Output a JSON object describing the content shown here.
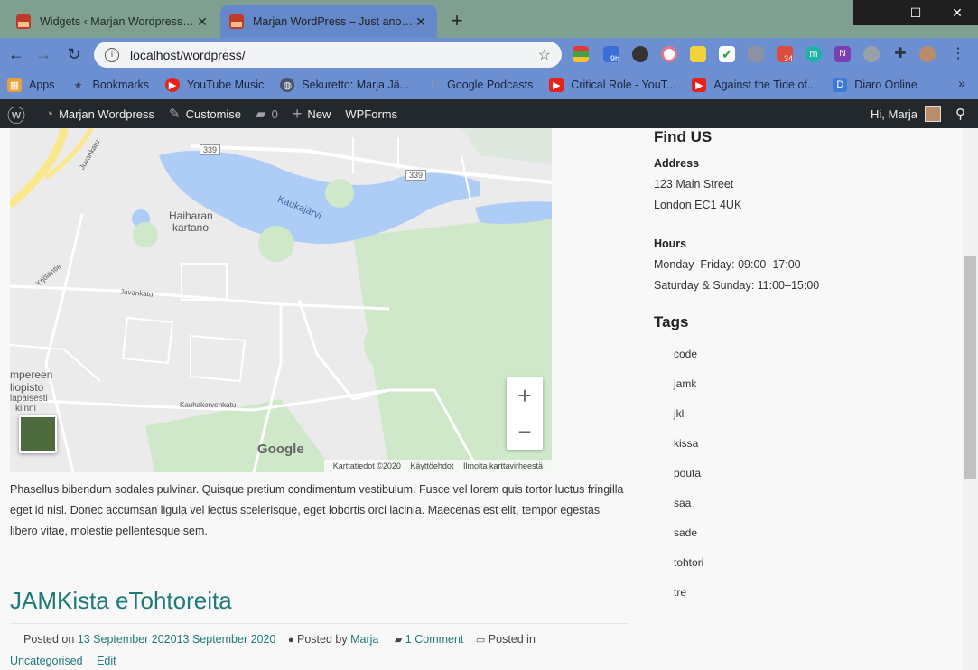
{
  "browser": {
    "tabs": [
      {
        "title": "Widgets ‹ Marjan Wordpress — WordPress"
      },
      {
        "title": "Marjan WordPress – Just another WordPress site"
      }
    ],
    "new_tab": "+",
    "window_controls": {
      "minimize": "—",
      "maximize": "☐",
      "close": "✕"
    },
    "url": "localhost/wordpress/",
    "extension_badges": {
      "timer": "9h",
      "todo": "34"
    },
    "bookmarks": [
      {
        "label": "Apps",
        "icon": "apps-grid-icon",
        "color": "#e8a03a"
      },
      {
        "label": "Bookmarks",
        "icon": "star-icon",
        "color": "#5a6480"
      },
      {
        "label": "YouTube Music",
        "icon": "youtube-music-icon",
        "color": "#e62117"
      },
      {
        "label": "Sekuretto: Marja Jä...",
        "icon": "globe-icon",
        "color": "#5a6480"
      },
      {
        "label": "Google Podcasts",
        "icon": "google-podcasts-icon",
        "color": "#f4b400"
      },
      {
        "label": "Critical Role - YouT...",
        "icon": "youtube-icon",
        "color": "#e62117"
      },
      {
        "label": "Against the Tide of...",
        "icon": "youtube-icon",
        "color": "#e62117"
      },
      {
        "label": "Diaro Online",
        "icon": "diaro-icon",
        "color": "#3a7bd5"
      }
    ],
    "bookmarks_more": "»"
  },
  "adminbar": {
    "site_name": "Marjan Wordpress",
    "customise": "Customise",
    "comments_count": "0",
    "new": "New",
    "wpforms": "WPForms",
    "greeting": "Hi, Marja"
  },
  "map": {
    "labels": {
      "road_339a": "339",
      "road_339b": "339",
      "lake": "Kaukajärvi",
      "place1": "Haiharan",
      "place2": "kartano",
      "road1": "Juvankatu",
      "road2": "Juvankatu",
      "road3": "Yrjöläntie",
      "road4": "Kauhakorvenkatu",
      "place3": "mpereen",
      "place4": "liopisto",
      "place5": "lapäisesti",
      "place6": "kiinni"
    },
    "zoom_in": "+",
    "zoom_out": "−",
    "google": "Google",
    "attribution": {
      "data": "Karttatiedot ©2020",
      "terms": "Käyttöehdot",
      "report": "Ilmoita karttavirheestä"
    }
  },
  "post": {
    "excerpt": "Phasellus bibendum sodales pulvinar. Quisque pretium condimentum vestibulum. Fusce vel lorem quis tortor luctus fringilla eget id nisl. Donec accumsan ligula vel lectus scelerisque, eget lobortis orci lacinia. Maecenas est elit, tempor egestas libero vitae, molestie pellentesque sem.",
    "next_title": "JAMKista eTohtoreita",
    "meta": {
      "posted_on_label": "Posted on",
      "date": "13 September 202013 September 2020",
      "posted_by_label": "Posted by",
      "author": "Marja",
      "comments": "1 Comment",
      "posted_in_label": "Posted in",
      "category": "Uncategorised",
      "edit": "Edit"
    }
  },
  "sidebar": {
    "find_us_heading": "Find US",
    "address_label": "Address",
    "address_line1": "123 Main Street",
    "address_line2": "London EC1 4UK",
    "hours_label": "Hours",
    "hours_line1": "Monday–Friday: 09:00–17:00",
    "hours_line2": "Saturday & Sunday: 11:00–15:00",
    "tags_heading": "Tags",
    "tags": [
      "code",
      "jamk",
      "jkl",
      "kissa",
      "pouta",
      "saa",
      "sade",
      "tohtori",
      "tre"
    ]
  }
}
